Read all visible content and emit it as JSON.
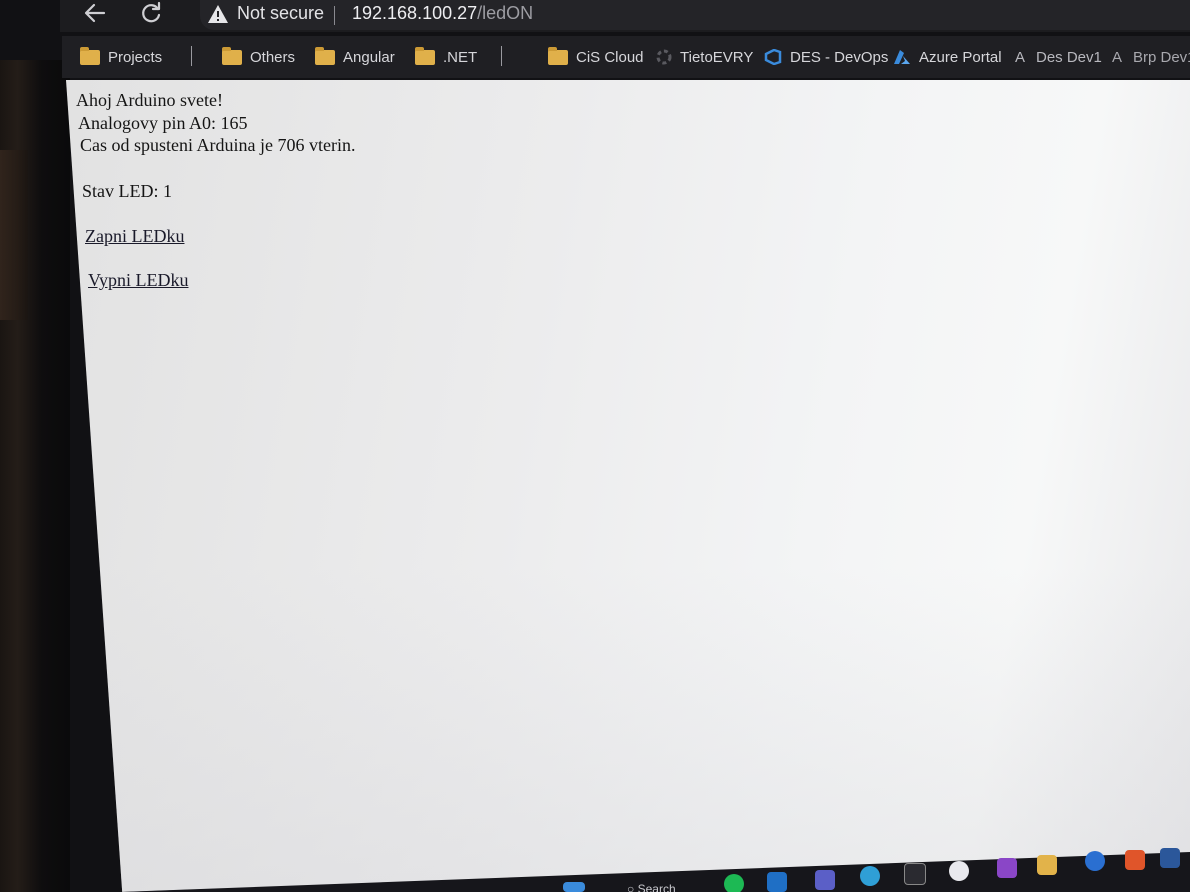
{
  "browser": {
    "security_label": "Not secure",
    "url_host": "192.168.100.27",
    "url_path": "/ledON",
    "nav": {
      "back_icon": "arrow-left-icon",
      "reload_icon": "reload-icon"
    }
  },
  "bookmarks": [
    {
      "label": "Projects",
      "icon": "folder-icon"
    },
    {
      "label": "Others",
      "icon": "folder-icon"
    },
    {
      "label": "Angular",
      "icon": "folder-icon"
    },
    {
      "label": ".NET",
      "icon": "folder-icon"
    },
    {
      "label": "CiS Cloud",
      "icon": "folder-icon"
    },
    {
      "label": "TietoEVRY",
      "icon": "tietoevry-icon"
    },
    {
      "label": "DES - DevOps",
      "icon": "azure-devops-icon"
    },
    {
      "label": "Azure Portal",
      "icon": "azure-icon"
    },
    {
      "label": "Des Dev1",
      "icon": "azure-icon"
    },
    {
      "label": "Brp Dev1",
      "icon": "azure-icon"
    }
  ],
  "page": {
    "greeting": "Ahoj Arduino svete!",
    "analog_pin": "Analogovy pin A0: 165",
    "uptime": "Cas od spusteni Arduina je 706 vterin.",
    "led_state": "Stav LED: 1",
    "link_on": "Zapni LEDku",
    "link_off": "Vypni LEDku"
  },
  "taskbar": {
    "search_label": "Search",
    "icons": [
      "windows-start-icon",
      "search-icon",
      "spotify-icon",
      "outlook-icon",
      "teams-icon",
      "weather-icon",
      "webstorm-icon",
      "app-icon",
      "visual-studio-icon",
      "file-explorer-icon",
      "app-icon",
      "app-icon",
      "word-icon"
    ]
  },
  "colors": {
    "chrome_dark": "#1c1c1f",
    "page_bg": "#f0f0f1",
    "folder": "#e0b04a",
    "azure_blue": "#3a8bdc"
  }
}
